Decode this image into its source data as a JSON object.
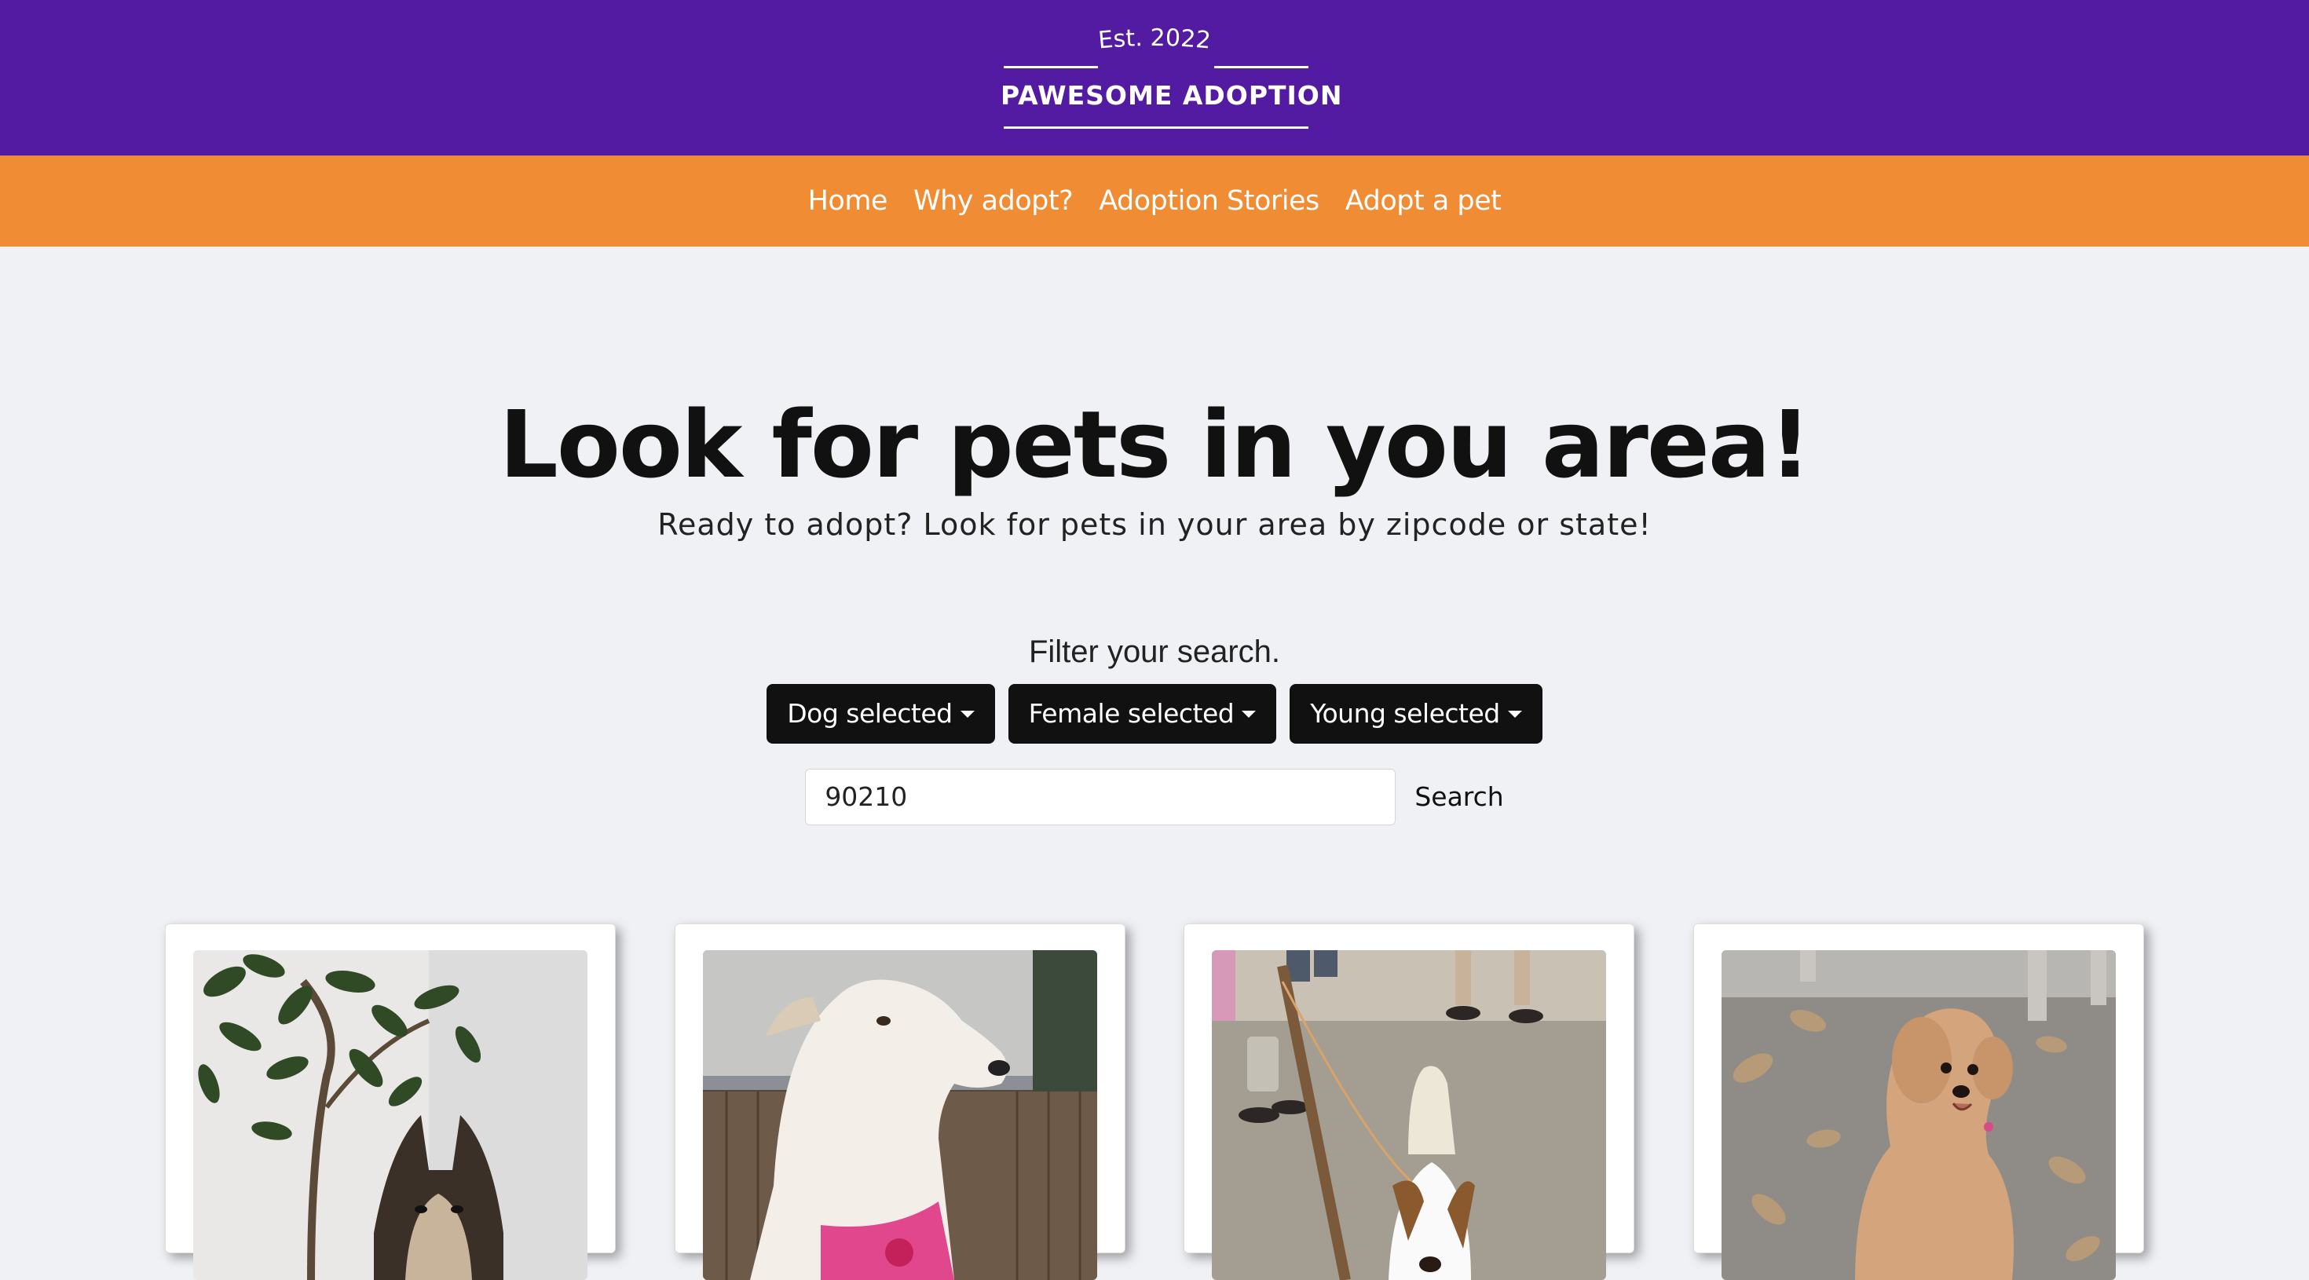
{
  "brand": {
    "established": "Est. 2022",
    "name": "PAWESOME ADOPTION"
  },
  "nav": {
    "items": [
      "Home",
      "Why adopt?",
      "Adoption Stories",
      "Adopt a pet"
    ]
  },
  "hero": {
    "title": "Look for pets in you area!",
    "subtitle": "Ready to adopt? Look for pets in your area by zipcode or state!"
  },
  "filter": {
    "title": "Filter your search.",
    "dropdowns": [
      "Dog selected",
      "Female selected",
      "Young selected"
    ],
    "search_value": "90210",
    "search_button": "Search"
  },
  "cards": [
    {
      "photo": "husky-puppy-with-plant-photo"
    },
    {
      "photo": "white-dog-with-pink-harness-photo"
    },
    {
      "photo": "hound-puppy-on-leash-photo"
    },
    {
      "photo": "golden-doodle-on-gravel-photo"
    }
  ],
  "colors": {
    "brand_purple": "#531ba1",
    "nav_orange": "#f08c34",
    "page_bg": "#f0f1f5",
    "button_dark": "#111111"
  }
}
